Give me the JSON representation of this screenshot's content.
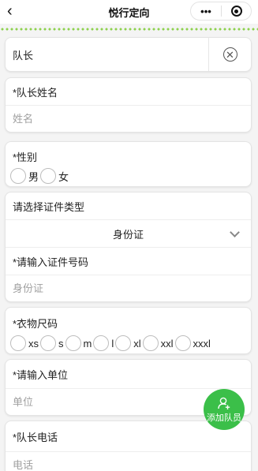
{
  "nav": {
    "back_glyph": "‹",
    "title": "悦行定向",
    "menu_glyph": "•••"
  },
  "captain_header": {
    "label": "队长",
    "delete_icon": "close-circle-icon"
  },
  "name": {
    "label": "*队长姓名",
    "placeholder": "姓名"
  },
  "gender": {
    "label": "*性别",
    "options": [
      "男",
      "女"
    ]
  },
  "id_type": {
    "label": "请选择证件类型",
    "selected": "身份证"
  },
  "id_number": {
    "label": "*请输入证件号码",
    "placeholder": "身份证"
  },
  "clothes": {
    "label": "*衣物尺码",
    "options": [
      "xs",
      "s",
      "m",
      "l",
      "xl",
      "xxl",
      "xxxl"
    ]
  },
  "unit": {
    "label": "*请输入单位",
    "placeholder": "单位"
  },
  "phone": {
    "label": "*队长电话",
    "placeholder": "电话"
  },
  "fab": {
    "label": "添加队员",
    "icon": "add-user-icon"
  },
  "colors": {
    "accent": "#3bbf49",
    "dots": "#8ed14e"
  }
}
